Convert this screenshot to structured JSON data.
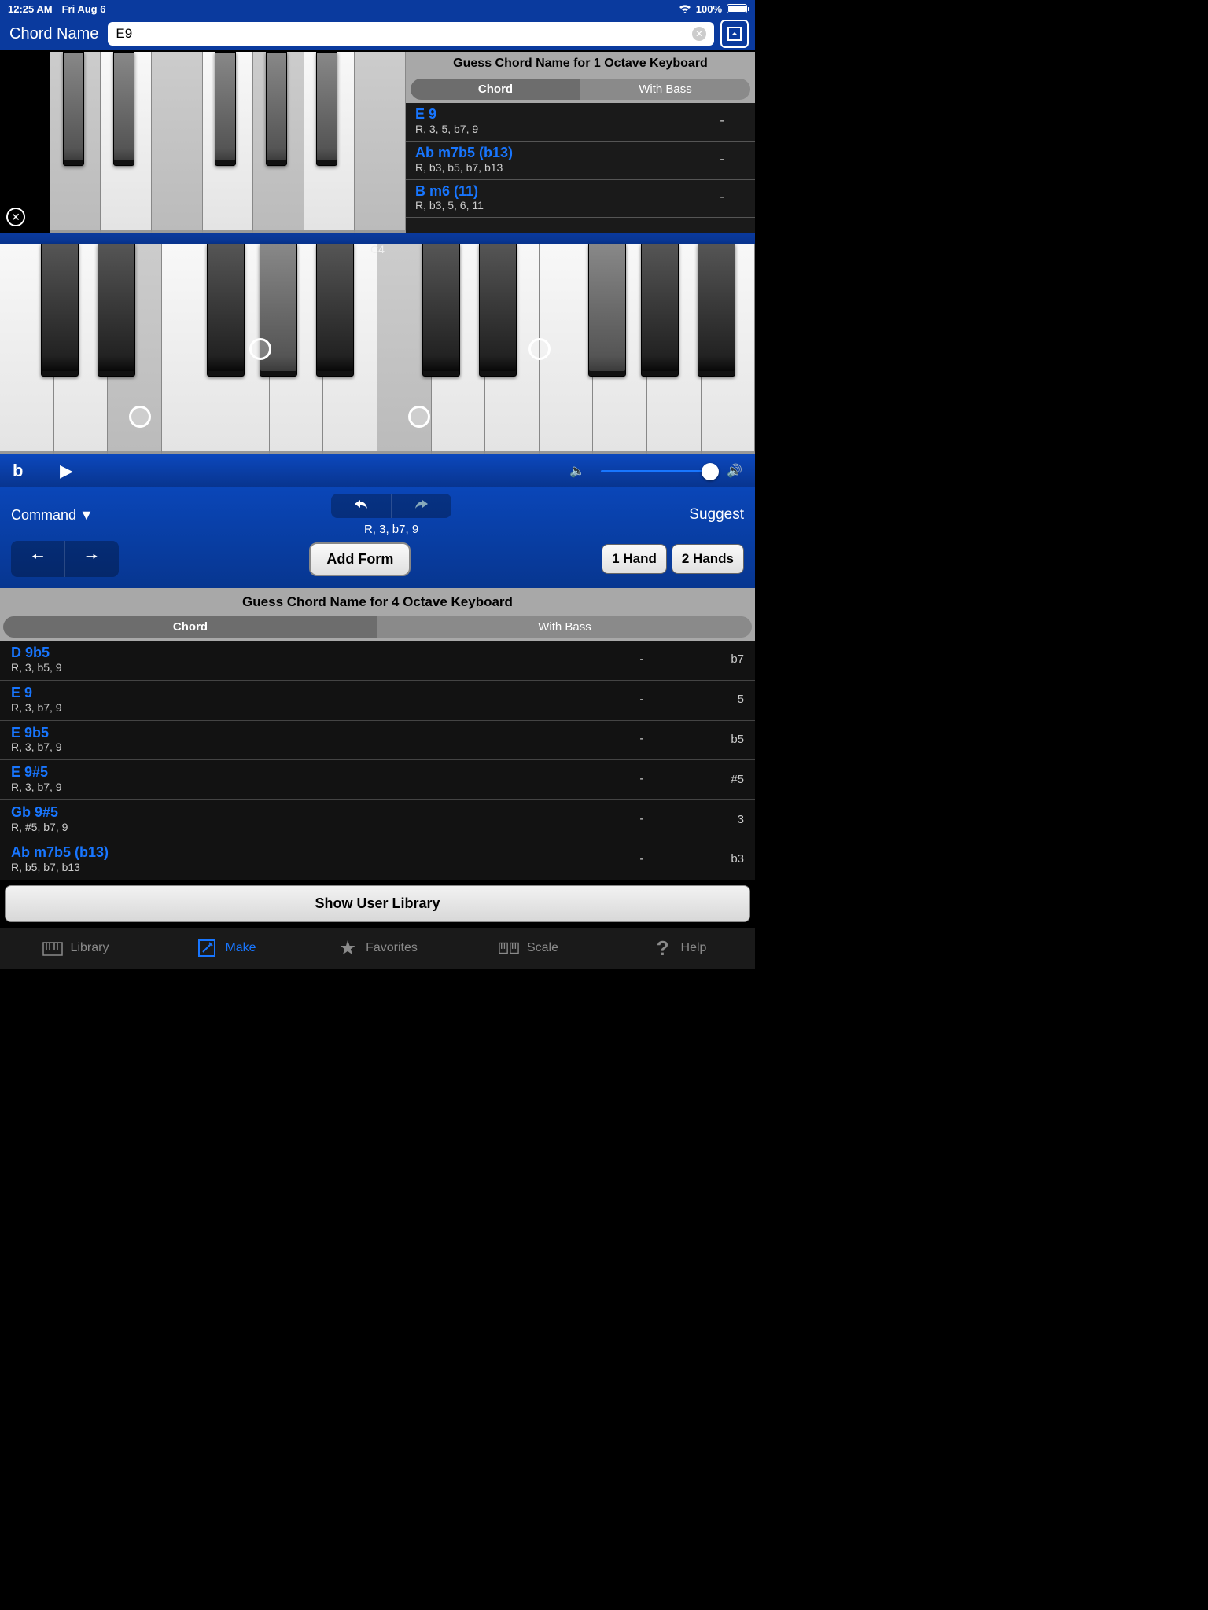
{
  "status": {
    "time": "12:25 AM",
    "date": "Fri Aug 6",
    "battery": "100%"
  },
  "header": {
    "title": "Chord Name",
    "search_value": "E9"
  },
  "guess1": {
    "title": "Guess Chord Name for 1 Octave Keyboard",
    "seg": {
      "chord": "Chord",
      "bass": "With Bass"
    },
    "rows": [
      {
        "name": "E 9",
        "ints": "R, 3, 5, b7, 9",
        "mid": "-"
      },
      {
        "name": "Ab m7b5 (b13)",
        "ints": "R, b3, b5, b7, b13",
        "mid": "-"
      },
      {
        "name": "B m6 (11)",
        "ints": "R, b3, 5, 6, 11",
        "mid": "-"
      }
    ]
  },
  "bigkbd": {
    "center_label": "C4"
  },
  "playrow": {
    "flat": "b"
  },
  "cmd": {
    "label": "Command",
    "ints": "R, 3, b7, 9",
    "add_form": "Add Form",
    "suggest": "Suggest",
    "hand1": "1 Hand",
    "hand2": "2 Hands"
  },
  "guess4": {
    "title": "Guess Chord Name for 4 Octave Keyboard",
    "seg": {
      "chord": "Chord",
      "bass": "With Bass"
    },
    "rows": [
      {
        "name": "D 9b5",
        "ints": "R, 3, b5, 9",
        "mid": "-",
        "right": "b7"
      },
      {
        "name": "E 9",
        "ints": "R, 3, b7, 9",
        "mid": "-",
        "right": "5"
      },
      {
        "name": "E 9b5",
        "ints": "R, 3, b7, 9",
        "mid": "-",
        "right": "b5"
      },
      {
        "name": "E 9#5",
        "ints": "R, 3, b7, 9",
        "mid": "-",
        "right": "#5"
      },
      {
        "name": "Gb 9#5",
        "ints": "R, #5, b7, 9",
        "mid": "-",
        "right": "3"
      },
      {
        "name": "Ab m7b5 (b13)",
        "ints": "R, b5, b7, b13",
        "mid": "-",
        "right": "b3"
      }
    ]
  },
  "show_lib": "Show User Library",
  "tabs": {
    "library": "Library",
    "make": "Make",
    "favorites": "Favorites",
    "scale": "Scale",
    "help": "Help"
  }
}
